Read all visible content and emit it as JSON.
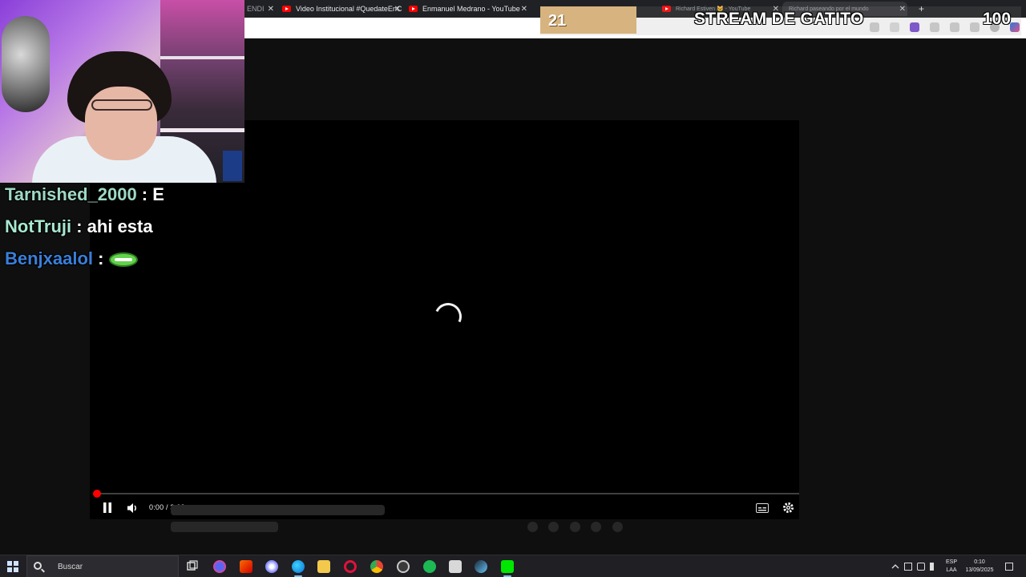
{
  "browser": {
    "tabs": [
      {
        "label": "ENDI"
      },
      {
        "label": "Video Institucional #QuedateEnC"
      },
      {
        "label": "Enmanuel Medrano - YouTube"
      },
      {
        "label": "Richard Estiven 🐱 - YouTube"
      },
      {
        "label": "Richard paseando por el mundo"
      }
    ]
  },
  "player": {
    "time": "0:00 / 3:02",
    "progress_fraction": 0.0
  },
  "stream": {
    "follower_count": "21",
    "title": "STREAM DE GATITO",
    "goal": "100"
  },
  "chat": [
    {
      "user": "Tarnished_2000",
      "message": "E",
      "color": "#9fd9c6"
    },
    {
      "user": "NotTruji",
      "message": "ahi esta",
      "color": "#a8e8d0"
    },
    {
      "user": "Benjxaalol",
      "message": "",
      "emote": "green-lips-emote",
      "color": "#3a7fd9"
    }
  ],
  "chat_separator": " : ",
  "taskbar": {
    "search_placeholder": "Buscar",
    "language_top": "ESP",
    "language_bottom": "LAA",
    "time": "0:10",
    "date": "13/09/2025"
  },
  "colors": {
    "youtube_red": "#ff0000",
    "page_bg": "#0f0f0f",
    "skeleton": "#272727"
  }
}
